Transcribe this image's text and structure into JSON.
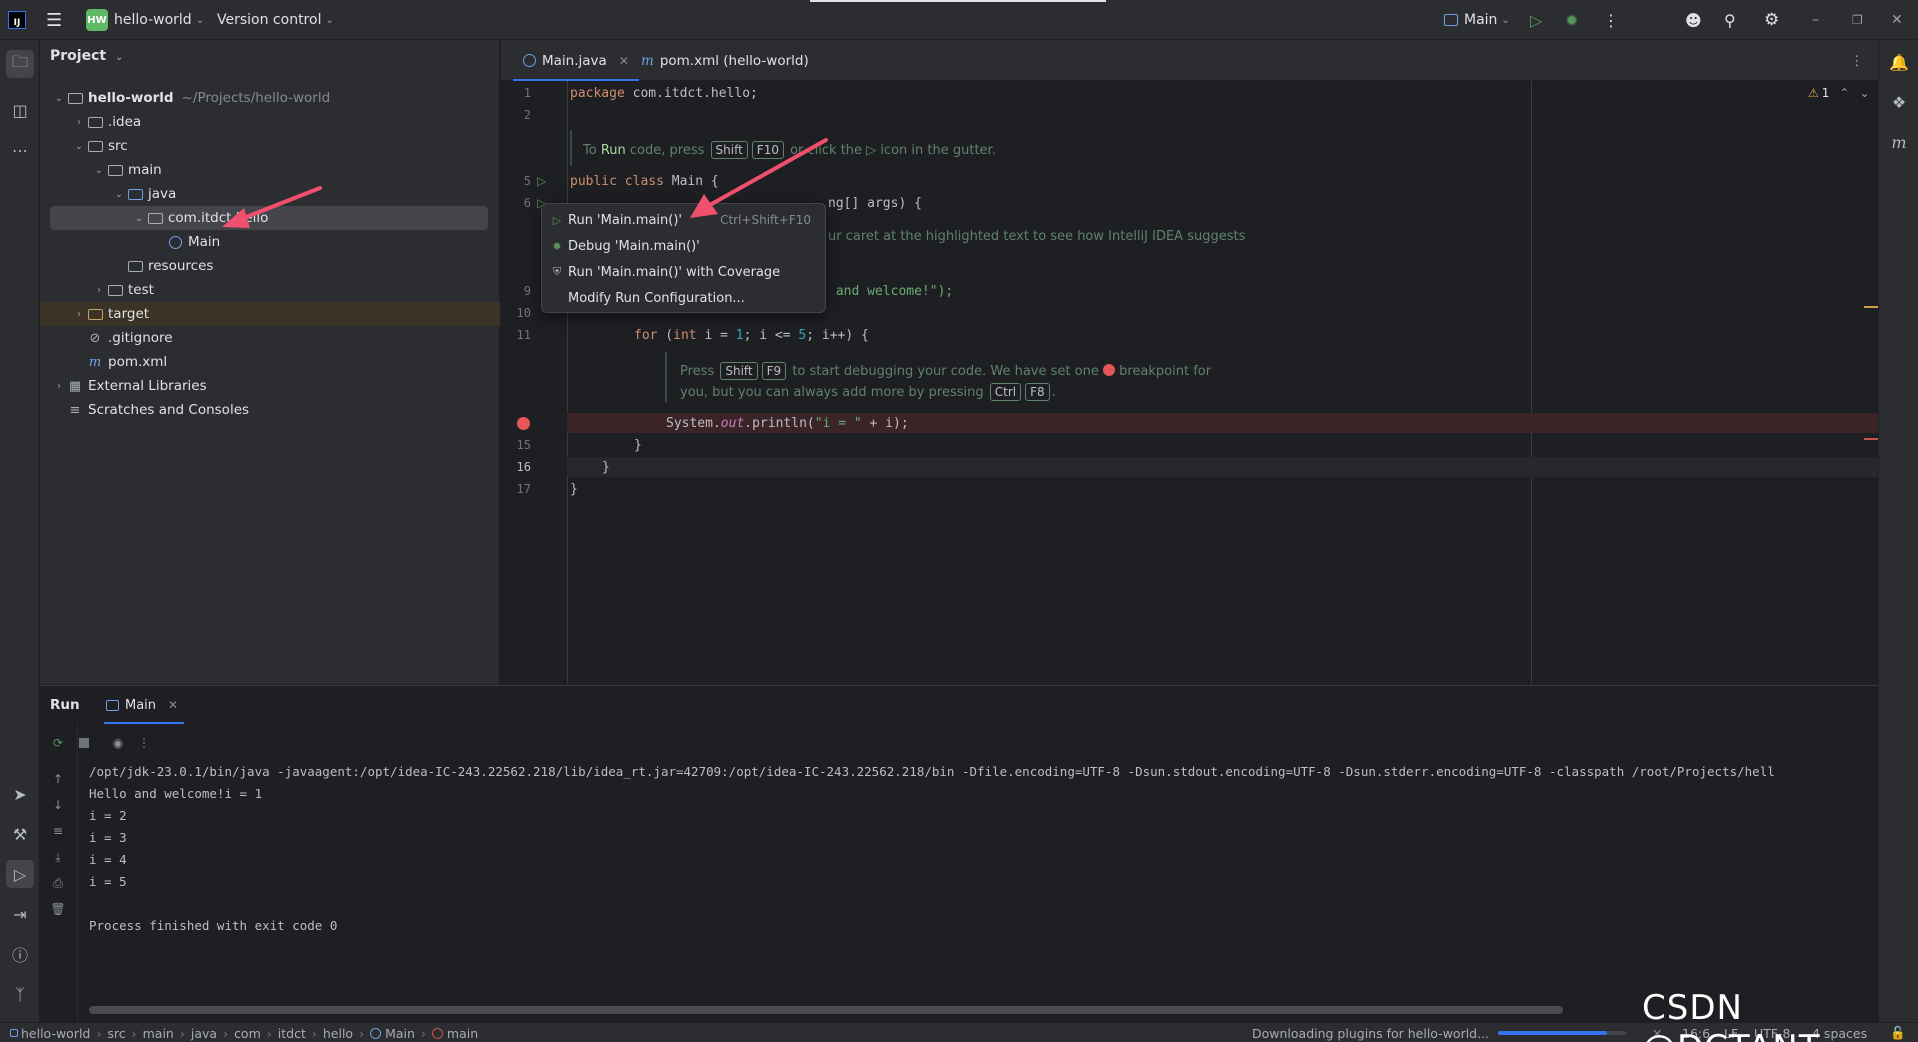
{
  "titlebar": {
    "project_badge": "HW",
    "project_name": "hello-world",
    "vcs": "Version control",
    "run_config": "Main"
  },
  "project_panel": {
    "title": "Project",
    "tree": [
      {
        "label": "hello-world",
        "path": "~/Projects/hello-world"
      },
      {
        "label": ".idea"
      },
      {
        "label": "src"
      },
      {
        "label": "main"
      },
      {
        "label": "java"
      },
      {
        "label": "com.itdct.hello"
      },
      {
        "label": "Main"
      },
      {
        "label": "resources"
      },
      {
        "label": "test"
      },
      {
        "label": "target"
      },
      {
        "label": ".gitignore"
      },
      {
        "label": "pom.xml"
      },
      {
        "label": "External Libraries"
      },
      {
        "label": "Scratches and Consoles"
      }
    ]
  },
  "editor": {
    "tabs": [
      {
        "label": "Main.java"
      },
      {
        "label": "pom.xml (hello-world)"
      }
    ],
    "warning_count": "1",
    "line_numbers": [
      "1",
      "2",
      "5",
      "6",
      "9",
      "10",
      "11",
      "15",
      "16",
      "17"
    ],
    "code": {
      "l1_kw": "package",
      "l1_rest": " com.itdct.hello;",
      "l5_kw": "public class",
      "l5_rest": " Main {",
      "l6_tail": "ng[] args) {",
      "l9_str": " and welcome!\");",
      "l11_for": "for",
      "l11_int": "int",
      "l11_a": " (",
      "l11_b": " i = ",
      "l11_n1": "1",
      "l11_c": "; i <= ",
      "l11_n2": "5",
      "l11_d": "; i++) {",
      "l14_a": "System.",
      "l14_out": "out",
      "l14_b": ".println(",
      "l14_str": "\"i = \"",
      "l14_c": " + i);",
      "l15": "}",
      "l16": "}",
      "l17": "}"
    },
    "hint1": {
      "a": "To ",
      "run": "Run",
      "b": " code, press",
      "key1": "Shift",
      "key2": "F10",
      "c": " or click the",
      "d": " icon in the gutter."
    },
    "hint2": "ur caret at the highlighted text to see how IntelliJ IDEA suggests",
    "hint3": {
      "a": "Press",
      "key1": "Shift",
      "key2": "F9",
      "b": " to start debugging your code. We have set one",
      "c": " breakpoint for"
    },
    "hint4": {
      "a": "you, but you can always add more by pressing",
      "key1": "Ctrl",
      "key2": "F8",
      "b": "."
    }
  },
  "context_menu": {
    "items": [
      {
        "label": "Run 'Main.main()'",
        "shortcut": "Ctrl+Shift+F10"
      },
      {
        "label": "Debug 'Main.main()'"
      },
      {
        "label": "Run 'Main.main()' with Coverage"
      },
      {
        "label": "Modify Run Configuration..."
      }
    ]
  },
  "run_panel": {
    "title": "Run",
    "tab": "Main",
    "output": [
      "/opt/jdk-23.0.1/bin/java -javaagent:/opt/idea-IC-243.22562.218/lib/idea_rt.jar=42709:/opt/idea-IC-243.22562.218/bin -Dfile.encoding=UTF-8 -Dsun.stdout.encoding=UTF-8 -Dsun.stderr.encoding=UTF-8 -classpath /root/Projects/hell",
      "Hello and welcome!i = 1",
      "i = 2",
      "i = 3",
      "i = 4",
      "i = 5",
      "",
      "Process finished with exit code 0"
    ]
  },
  "statusbar": {
    "breadcrumb": [
      "hello-world",
      "src",
      "main",
      "java",
      "com",
      "itdct",
      "hello",
      "Main",
      "main"
    ],
    "progress_text": "Downloading plugins for hello-world...",
    "progress_fraction": 0.85,
    "position": "16:6",
    "line_sep": "LF",
    "encoding": "UTF-8",
    "indent": "4 spaces"
  },
  "watermark": "CSDN @DCTANT",
  "colors": {
    "accent": "#3574f0",
    "run_green": "#57965c",
    "breakpoint": "#e55757",
    "arrow": "#f0506e"
  }
}
